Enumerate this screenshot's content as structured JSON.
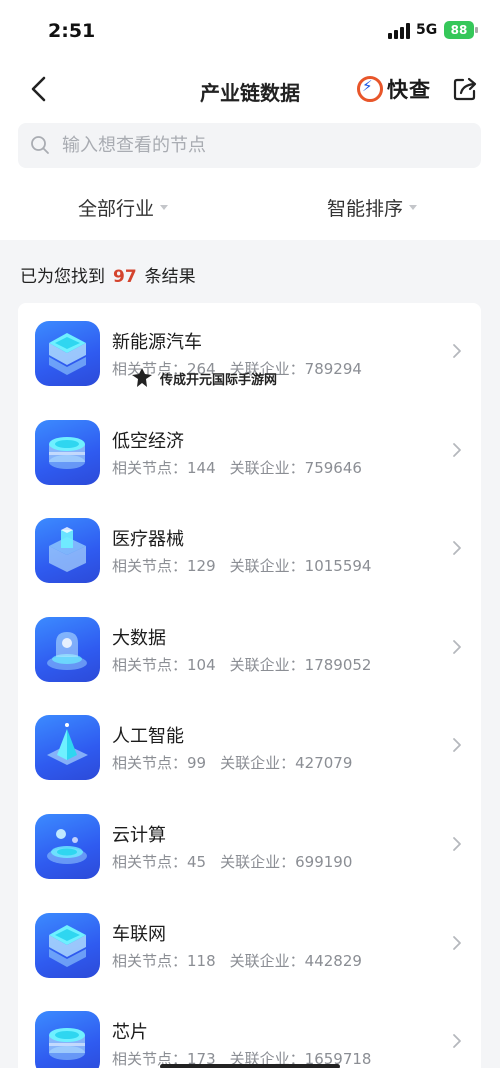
{
  "status_bar": {
    "time": "2:51",
    "network": "5G",
    "battery": "88"
  },
  "nav": {
    "title": "产业链数据",
    "logo_text": "快查"
  },
  "search": {
    "placeholder": "输入想查看的节点"
  },
  "filters": {
    "industry": "全部行业",
    "sort": "智能排序"
  },
  "result": {
    "prefix": "已为您找到",
    "count": "97",
    "suffix": "条结果"
  },
  "labels": {
    "nodes": "相关节点：",
    "companies": "关联企业："
  },
  "watermark": "传成开元国际手游网",
  "items": [
    {
      "title": "新能源汽车",
      "nodes": "264",
      "companies": "789294",
      "icon": "server-stack-icon"
    },
    {
      "title": "低空经济",
      "nodes": "144",
      "companies": "759646",
      "icon": "database-disc-icon"
    },
    {
      "title": "医疗器械",
      "nodes": "129",
      "companies": "1015594",
      "icon": "box-cube-icon"
    },
    {
      "title": "大数据",
      "nodes": "104",
      "companies": "1789052",
      "icon": "dome-icon"
    },
    {
      "title": "人工智能",
      "nodes": "99",
      "companies": "427079",
      "icon": "pyramid-icon"
    },
    {
      "title": "云计算",
      "nodes": "45",
      "companies": "699190",
      "icon": "cloud-platform-icon"
    },
    {
      "title": "车联网",
      "nodes": "118",
      "companies": "442829",
      "icon": "server-stack-icon"
    },
    {
      "title": "芯片",
      "nodes": "173",
      "companies": "1659718",
      "icon": "database-disc-icon"
    }
  ]
}
